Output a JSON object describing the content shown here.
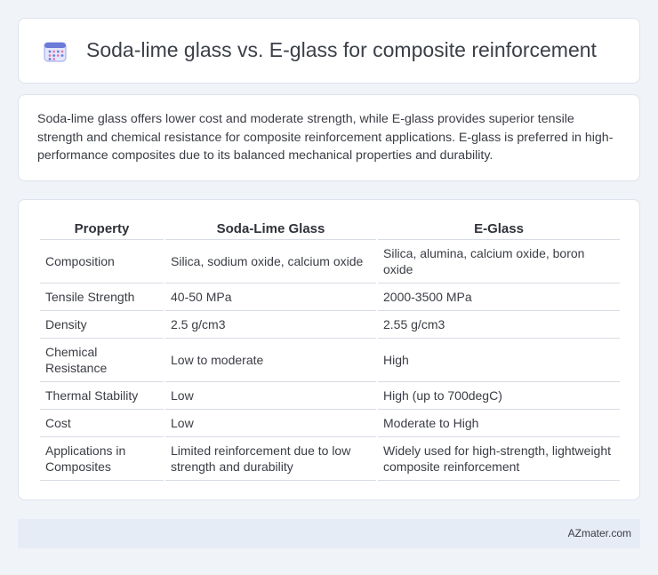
{
  "header": {
    "title": "Soda-lime glass vs. E-glass for composite reinforcement",
    "icon": "calendar-icon"
  },
  "summary": {
    "text": "Soda-lime glass offers lower cost and moderate strength, while E-glass provides superior tensile strength and chemical resistance for composite reinforcement applications. E-glass is preferred in high-performance composites due to its balanced mechanical properties and durability."
  },
  "table": {
    "headers": [
      "Property",
      "Soda-Lime Glass",
      "E-Glass"
    ],
    "rows": [
      [
        "Composition",
        "Silica, sodium oxide, calcium oxide",
        "Silica, alumina, calcium oxide, boron oxide"
      ],
      [
        "Tensile Strength",
        "40-50 MPa",
        "2000-3500 MPa"
      ],
      [
        "Density",
        "2.5 g/cm3",
        "2.55 g/cm3"
      ],
      [
        "Chemical Resistance",
        "Low to moderate",
        "High"
      ],
      [
        "Thermal Stability",
        "Low",
        "High (up to 700degC)"
      ],
      [
        "Cost",
        "Low",
        "Moderate to High"
      ],
      [
        "Applications in Composites",
        "Limited reinforcement due to low strength and durability",
        "Widely used for high-strength, lightweight composite reinforcement"
      ]
    ]
  },
  "footer": {
    "site": "AZmater.com"
  },
  "colors": {
    "background": "#f0f3f8",
    "card": "#ffffff",
    "footer_bar": "#e6ecf6",
    "icon_accent": "#6c7bd8"
  }
}
